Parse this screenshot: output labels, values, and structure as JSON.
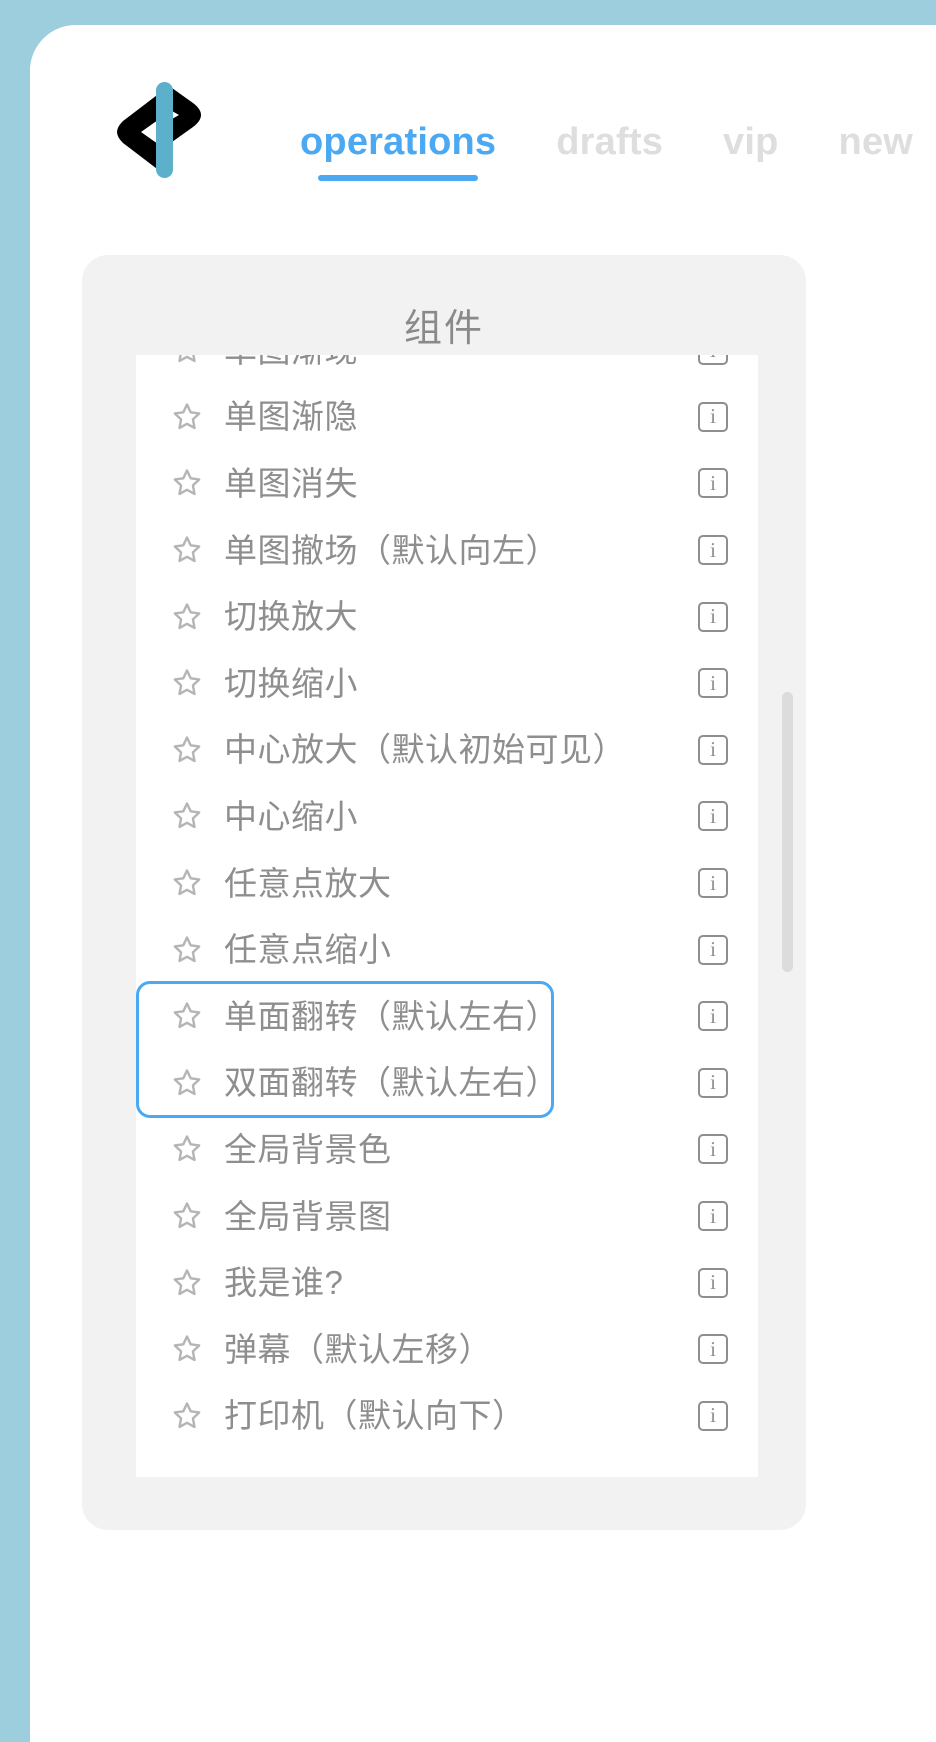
{
  "theme": {
    "page_background": "#9ccedd",
    "panel_background": "#ffffff",
    "accent": "#4aa9f2",
    "muted_text": "#8e8e8e",
    "inactive_tab": "#dedede",
    "card_background": "#f2f2f2"
  },
  "logo": {
    "name": "app-logo",
    "alt": "chevron-bar-logo"
  },
  "tabs": [
    {
      "label": "operations",
      "active": true
    },
    {
      "label": "drafts",
      "active": false
    },
    {
      "label": "vip",
      "active": false
    },
    {
      "label": "new",
      "active": false
    }
  ],
  "card": {
    "title": "组件",
    "scrollbar": {
      "thumb_top_pct": 55,
      "thumb_height_pct": 25
    }
  },
  "list": {
    "items": [
      {
        "label": "单图渐现",
        "favorited": false,
        "highlighted": false
      },
      {
        "label": "单图渐隐",
        "favorited": false,
        "highlighted": false
      },
      {
        "label": "单图消失",
        "favorited": false,
        "highlighted": false
      },
      {
        "label": "单图撤场（默认向左）",
        "favorited": false,
        "highlighted": false
      },
      {
        "label": "切换放大",
        "favorited": false,
        "highlighted": false
      },
      {
        "label": "切换缩小",
        "favorited": false,
        "highlighted": false
      },
      {
        "label": "中心放大（默认初始可见）",
        "favorited": false,
        "highlighted": false
      },
      {
        "label": "中心缩小",
        "favorited": false,
        "highlighted": false
      },
      {
        "label": "任意点放大",
        "favorited": false,
        "highlighted": false
      },
      {
        "label": "任意点缩小",
        "favorited": false,
        "highlighted": false
      },
      {
        "label": "单面翻转（默认左右）",
        "favorited": false,
        "highlighted": true
      },
      {
        "label": "双面翻转（默认左右）",
        "favorited": false,
        "highlighted": true
      },
      {
        "label": "全局背景色",
        "favorited": false,
        "highlighted": false
      },
      {
        "label": "全局背景图",
        "favorited": false,
        "highlighted": false
      },
      {
        "label": "我是谁?",
        "favorited": false,
        "highlighted": false
      },
      {
        "label": "弹幕（默认左移）",
        "favorited": false,
        "highlighted": false
      },
      {
        "label": "打印机（默认向下）",
        "favorited": false,
        "highlighted": false
      }
    ],
    "row_icons": {
      "favorite": "star-icon",
      "info": "info-icon",
      "info_glyph": "i"
    }
  }
}
